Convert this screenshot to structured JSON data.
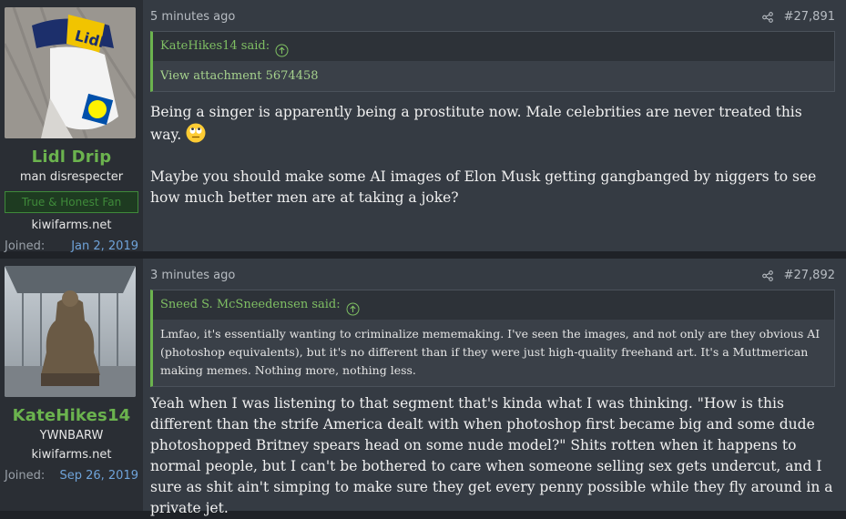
{
  "posts": [
    {
      "user": {
        "name": "Lidl Drip",
        "title": "man disrespecter",
        "banner": "True & Honest Fan",
        "site": "kiwifarms.net",
        "joined_label": "Joined:",
        "joined_date": "Jan 2, 2019"
      },
      "time": "5 minutes ago",
      "post_number": "#27,891",
      "quote": {
        "author": "KateHikes14 said:",
        "body": "View attachment 5674458"
      },
      "message": [
        "Being a singer is apparently being a prostitute now. Male celebrities are never treated this way.",
        "Maybe you should make some AI images of Elon Musk getting gangbanged by niggers to see how much better men are at taking a joke?"
      ]
    },
    {
      "user": {
        "name": "KateHikes14",
        "title": "YWNBARW",
        "site": "kiwifarms.net",
        "joined_label": "Joined:",
        "joined_date": "Sep 26, 2019"
      },
      "time": "3 minutes ago",
      "post_number": "#27,892",
      "quote": {
        "author": "Sneed S. McSneedensen said:",
        "body": "Lmfao, it's essentially wanting to criminalize mememaking. I've seen the images, and not only are they obvious AI (photoshop equivalents), but it's no different than if they were just high-quality freehand art. It's a Muttmerican making memes. Nothing more, nothing less."
      },
      "message": [
        "Yeah when I was listening to that segment that's kinda what I was thinking. \"How is this different than the strife America dealt with when photoshop first became big and some dude photoshopped Britney spears head on some nude model?\" Shits rotten when it happens to normal people, but I can't be bothered to care when someone selling sex gets undercut, and I sure as shit ain't simping to make sure they get every penny possible while they fly around in a private jet."
      ]
    }
  ],
  "colors": {
    "username": "#6bb34e",
    "link": "#6fa3d9",
    "quote_border": "#6bb34e"
  },
  "icons": [
    "share-icon",
    "quote-up-arrow-icon",
    "rolling-eyes-emoji"
  ]
}
